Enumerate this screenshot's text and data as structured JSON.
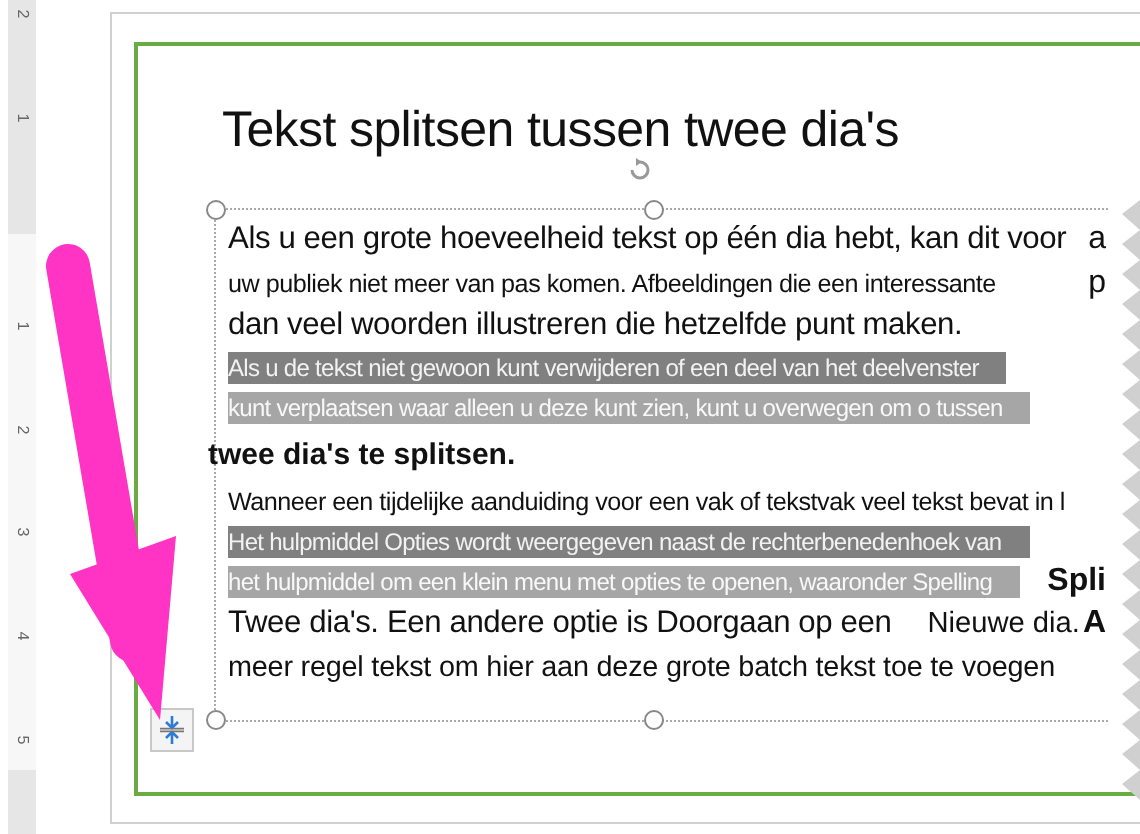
{
  "ruler": {
    "numbers": [
      "2",
      "1",
      "1",
      "2",
      "3",
      "4",
      "5"
    ]
  },
  "slide": {
    "title": "Tekst splitsen tussen twee dia's",
    "lines": [
      {
        "kind": "large",
        "text": "Als u een grote hoeveelheid tekst op één dia hebt, kan dit voor",
        "edge": "a"
      },
      {
        "kind": "small",
        "text": "uw publiek niet meer van pas komen. Afbeeldingen die een interessante",
        "edge": "p"
      },
      {
        "kind": "large",
        "text": "dan veel woorden illustreren die hetzelfde punt maken."
      },
      {
        "kind": "dark",
        "text": "Als u de tekst niet gewoon kunt verwijderen of een deel van het deelvenster"
      },
      {
        "kind": "light",
        "text": "kunt verplaatsen waar alleen u deze kunt zien, kunt u overwegen om o tussen"
      },
      {
        "kind": "outdent",
        "text": "twee dia's te splitsen."
      },
      {
        "kind": "small",
        "text": "Wanneer een tijdelijke aanduiding voor een vak of tekstvak veel tekst bevat in l"
      },
      {
        "kind": "dark",
        "text": "Het hulpmiddel Opties wordt weergegeven naast de rechterbenedenhoek van"
      },
      {
        "kind": "light",
        "text": "het hulpmiddel om een klein menu met opties te openen, waaronder Spelling",
        "edge": "Spli"
      },
      {
        "kind": "large",
        "text": "Twee dia's. Een andere optie is Doorgaan op een",
        "tail": "Nieuwe dia.",
        "edge": "A"
      },
      {
        "kind": "medium",
        "text": "meer regel tekst om hier aan deze grote batch tekst toe te voegen"
      }
    ]
  }
}
